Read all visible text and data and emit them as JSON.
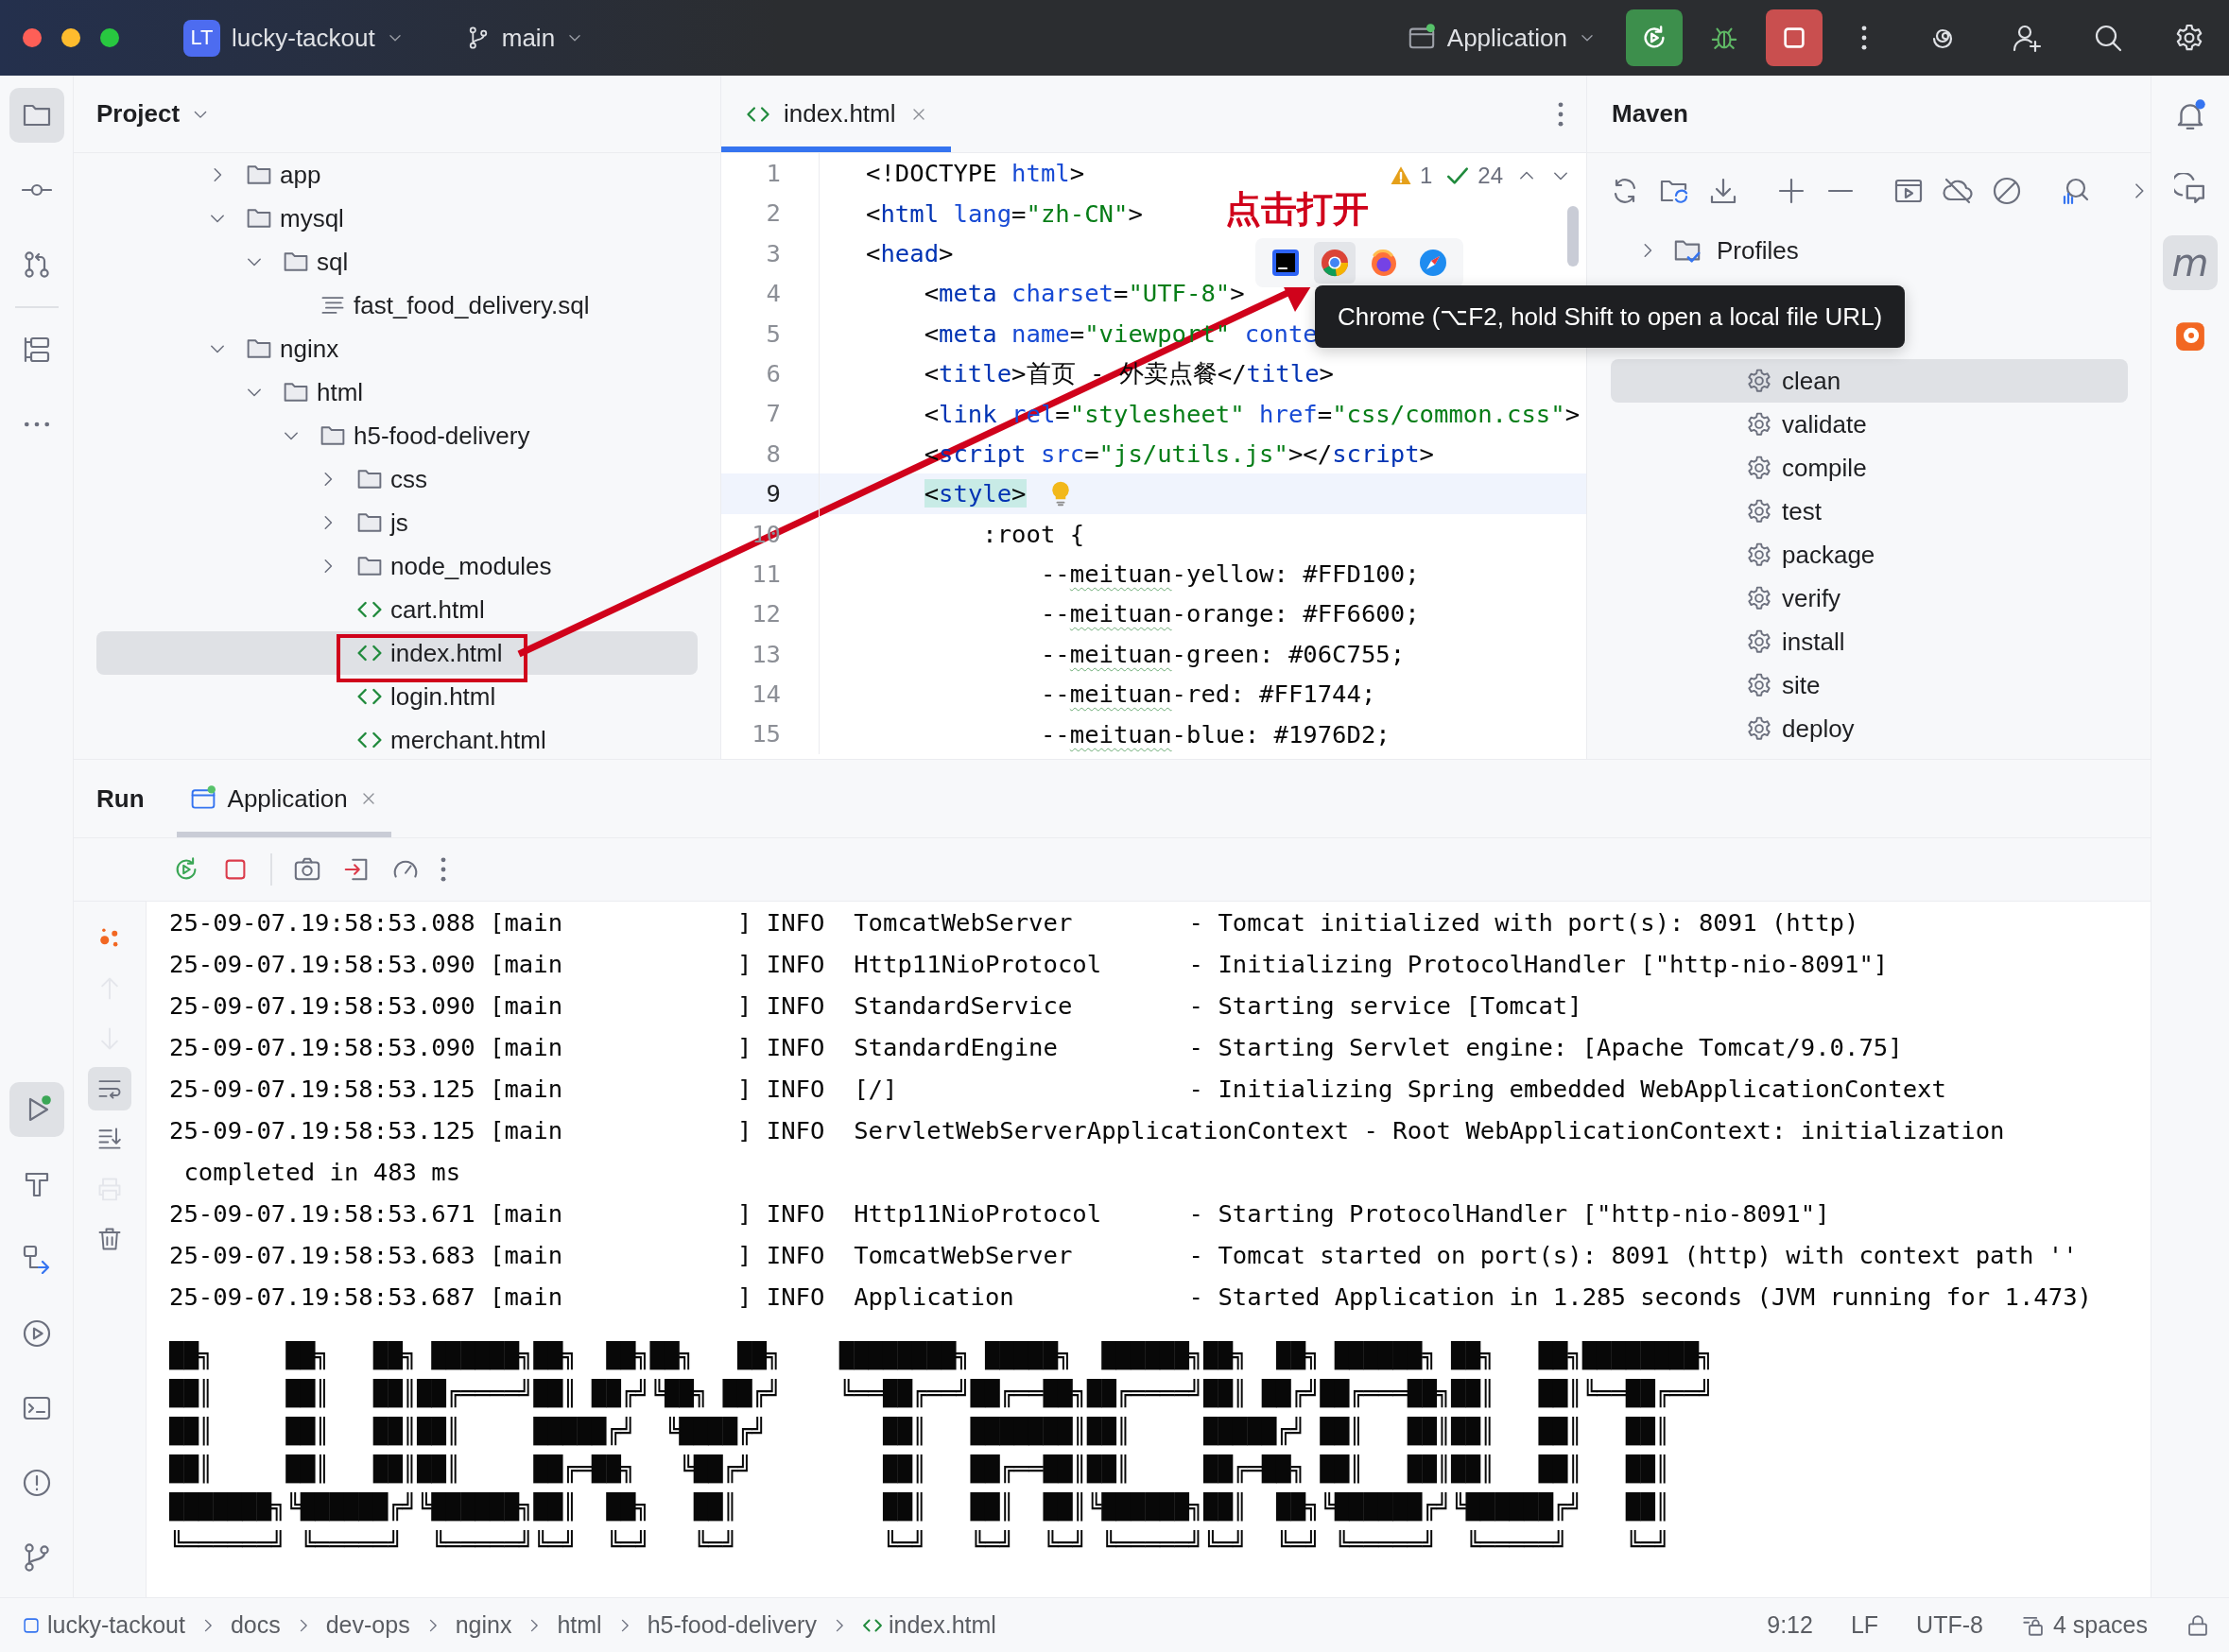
{
  "title_bar": {
    "project_badge": "LT",
    "project": "lucky-tackout",
    "branch": "main",
    "run_config": "Application"
  },
  "left_toolbar": {
    "top": [
      {
        "kind": "project",
        "selected": true
      },
      {
        "kind": "commit",
        "selected": false
      },
      {
        "kind": "pull-requests",
        "selected": false
      },
      {
        "kind": "structure",
        "selected": false
      },
      {
        "kind": "more",
        "selected": false
      }
    ],
    "bottom": [
      {
        "kind": "run",
        "selected": true
      },
      {
        "kind": "build",
        "selected": false
      },
      {
        "kind": "services",
        "selected": false
      },
      {
        "kind": "run-circle",
        "selected": false
      },
      {
        "kind": "terminal",
        "selected": false
      },
      {
        "kind": "problems",
        "selected": false
      },
      {
        "kind": "git",
        "selected": false
      }
    ]
  },
  "right_toolbar": [
    {
      "kind": "notifications",
      "selected": false
    },
    {
      "kind": "ai-chat",
      "selected": false
    },
    {
      "kind": "maven",
      "selected": true,
      "glyph": "m"
    },
    {
      "kind": "plugin",
      "selected": false
    }
  ],
  "project_panel": {
    "title": "Project",
    "tree": [
      {
        "name": "app",
        "kind": "folder",
        "expanded": false,
        "selected": false
      },
      {
        "name": "mysql",
        "kind": "folder",
        "expanded": true,
        "selected": false,
        "children": [
          {
            "name": "sql",
            "kind": "folder",
            "expanded": true,
            "selected": false,
            "children": [
              {
                "name": "fast_food_delivery.sql",
                "kind": "sql",
                "selected": false
              }
            ]
          }
        ]
      },
      {
        "name": "nginx",
        "kind": "folder",
        "expanded": true,
        "selected": false,
        "children": [
          {
            "name": "html",
            "kind": "folder",
            "expanded": true,
            "selected": false,
            "children": [
              {
                "name": "h5-food-delivery",
                "kind": "folder",
                "expanded": true,
                "selected": false,
                "children": [
                  {
                    "name": "css",
                    "kind": "folder",
                    "expanded": false,
                    "selected": false
                  },
                  {
                    "name": "js",
                    "kind": "folder",
                    "expanded": false,
                    "selected": false
                  },
                  {
                    "name": "node_modules",
                    "kind": "folder",
                    "expanded": false,
                    "selected": false
                  },
                  {
                    "name": "cart.html",
                    "kind": "html",
                    "selected": false
                  },
                  {
                    "name": "index.html",
                    "kind": "html",
                    "selected": true
                  },
                  {
                    "name": "login.html",
                    "kind": "html",
                    "selected": false
                  },
                  {
                    "name": "merchant.html",
                    "kind": "html",
                    "selected": false
                  }
                ]
              }
            ]
          }
        ]
      }
    ]
  },
  "editor": {
    "tab": {
      "label": "index.html",
      "selected": true
    },
    "inspections": {
      "warnings": "1",
      "passed": "24"
    },
    "lines": [
      {
        "number": "1",
        "current": false,
        "segments": [
          {
            "text": "<!DOCTYPE",
            "kind": "plain"
          },
          {
            "text": " html",
            "kind": "attr"
          },
          {
            "text": ">",
            "kind": "plain"
          }
        ]
      },
      {
        "number": "2",
        "current": false,
        "segments": [
          {
            "text": "<",
            "kind": "plain"
          },
          {
            "text": "html",
            "kind": "tag"
          },
          {
            "text": " lang",
            "kind": "attr"
          },
          {
            "text": "=",
            "kind": "plain"
          },
          {
            "text": "\"zh-CN\"",
            "kind": "str"
          },
          {
            "text": ">",
            "kind": "plain"
          }
        ]
      },
      {
        "number": "3",
        "current": false,
        "segments": [
          {
            "text": "<",
            "kind": "plain"
          },
          {
            "text": "head",
            "kind": "tag"
          },
          {
            "text": ">",
            "kind": "plain"
          }
        ]
      },
      {
        "number": "4",
        "current": false,
        "segments": [
          {
            "text": "    <",
            "kind": "plain"
          },
          {
            "text": "meta",
            "kind": "tag"
          },
          {
            "text": " charset",
            "kind": "attr"
          },
          {
            "text": "=",
            "kind": "plain"
          },
          {
            "text": "\"UTF-8\"",
            "kind": "str"
          },
          {
            "text": ">",
            "kind": "plain"
          }
        ]
      },
      {
        "number": "5",
        "current": false,
        "segments": [
          {
            "text": "    <",
            "kind": "plain"
          },
          {
            "text": "meta",
            "kind": "tag"
          },
          {
            "text": " name",
            "kind": "attr"
          },
          {
            "text": "=",
            "kind": "plain"
          },
          {
            "text": "\"viewport\"",
            "kind": "str"
          },
          {
            "text": " conte",
            "kind": "attr"
          }
        ]
      },
      {
        "number": "6",
        "current": false,
        "segments": [
          {
            "text": "    <",
            "kind": "plain"
          },
          {
            "text": "title",
            "kind": "tag"
          },
          {
            "text": ">首页 - 外卖点餐</",
            "kind": "plain"
          },
          {
            "text": "title",
            "kind": "tag"
          },
          {
            "text": ">",
            "kind": "plain"
          }
        ]
      },
      {
        "number": "7",
        "current": false,
        "segments": [
          {
            "text": "    <",
            "kind": "plain"
          },
          {
            "text": "link",
            "kind": "tag"
          },
          {
            "text": " rel",
            "kind": "attr"
          },
          {
            "text": "=",
            "kind": "plain"
          },
          {
            "text": "\"stylesheet\"",
            "kind": "str"
          },
          {
            "text": " href",
            "kind": "attr"
          },
          {
            "text": "=",
            "kind": "plain"
          },
          {
            "text": "\"css/common.css\"",
            "kind": "str"
          },
          {
            "text": ">",
            "kind": "plain"
          }
        ]
      },
      {
        "number": "8",
        "current": false,
        "segments": [
          {
            "text": "    <",
            "kind": "plain"
          },
          {
            "text": "script",
            "kind": "tag"
          },
          {
            "text": " src",
            "kind": "attr"
          },
          {
            "text": "=",
            "kind": "plain"
          },
          {
            "text": "\"js/utils.js\"",
            "kind": "str"
          },
          {
            "text": "></",
            "kind": "plain"
          },
          {
            "text": "script",
            "kind": "tag"
          },
          {
            "text": ">",
            "kind": "plain"
          }
        ]
      },
      {
        "number": "9",
        "current": true,
        "segments": [
          {
            "text": "    <",
            "kind": "match"
          },
          {
            "text": "style",
            "kind": "match-tag"
          },
          {
            "text": ">",
            "kind": "match"
          }
        ]
      },
      {
        "number": "10",
        "current": false,
        "segments": [
          {
            "text": "        :root {",
            "kind": "plain"
          }
        ]
      },
      {
        "number": "11",
        "current": false,
        "segments": [
          {
            "text": "            --",
            "kind": "plain"
          },
          {
            "text": "meituan",
            "kind": "typo"
          },
          {
            "text": "-yellow: #FFD100;",
            "kind": "plain"
          }
        ]
      },
      {
        "number": "12",
        "current": false,
        "segments": [
          {
            "text": "            --",
            "kind": "plain"
          },
          {
            "text": "meituan",
            "kind": "typo"
          },
          {
            "text": "-orange: #FF6600;",
            "kind": "plain"
          }
        ]
      },
      {
        "number": "13",
        "current": false,
        "segments": [
          {
            "text": "            --",
            "kind": "plain"
          },
          {
            "text": "meituan",
            "kind": "typo"
          },
          {
            "text": "-green: #06C755;",
            "kind": "plain"
          }
        ]
      },
      {
        "number": "14",
        "current": false,
        "segments": [
          {
            "text": "            --",
            "kind": "plain"
          },
          {
            "text": "meituan",
            "kind": "typo"
          },
          {
            "text": "-red: #FF1744;",
            "kind": "plain"
          }
        ]
      },
      {
        "number": "15",
        "current": false,
        "segments": [
          {
            "text": "            --",
            "kind": "plain"
          },
          {
            "text": "meituan",
            "kind": "typo"
          },
          {
            "text": "-blue: #1976D2;",
            "kind": "plain"
          }
        ]
      }
    ],
    "browser_popup": [
      {
        "kind": "intellij",
        "selected": false
      },
      {
        "kind": "chrome",
        "selected": true
      },
      {
        "kind": "firefox",
        "selected": false
      },
      {
        "kind": "safari",
        "selected": false
      }
    ],
    "tooltip": "Chrome (⌥F2, hold Shift to open a local file URL)"
  },
  "annotation": {
    "label": "点击打开"
  },
  "maven": {
    "title": "Maven",
    "profiles": {
      "name": "Profiles",
      "expanded": false
    },
    "lifecycle": [
      {
        "name": "clean",
        "selected": true
      },
      {
        "name": "validate",
        "selected": false
      },
      {
        "name": "compile",
        "selected": false
      },
      {
        "name": "test",
        "selected": false
      },
      {
        "name": "package",
        "selected": false
      },
      {
        "name": "verify",
        "selected": false
      },
      {
        "name": "install",
        "selected": false
      },
      {
        "name": "site",
        "selected": false
      },
      {
        "name": "deploy",
        "selected": false
      }
    ]
  },
  "run": {
    "title": "Run",
    "tab": {
      "label": "Application",
      "selected": true
    },
    "gutter": [
      {
        "kind": "spring",
        "selected": false,
        "disabled": false
      },
      {
        "kind": "up",
        "selected": false,
        "disabled": true
      },
      {
        "kind": "down",
        "selected": false,
        "disabled": true
      },
      {
        "kind": "wrap",
        "selected": true,
        "disabled": false
      },
      {
        "kind": "scroll-end",
        "selected": false,
        "disabled": false
      },
      {
        "kind": "print",
        "selected": false,
        "disabled": true
      },
      {
        "kind": "trash",
        "selected": false,
        "disabled": false
      }
    ],
    "console": [
      "25-09-07.19:58:53.088 [main            ] INFO  TomcatWebServer        - Tomcat initialized with port(s): 8091 (http)",
      "25-09-07.19:58:53.090 [main            ] INFO  Http11NioProtocol      - Initializing ProtocolHandler [\"http-nio-8091\"]",
      "25-09-07.19:58:53.090 [main            ] INFO  StandardService        - Starting service [Tomcat]",
      "25-09-07.19:58:53.090 [main            ] INFO  StandardEngine         - Starting Servlet engine: [Apache Tomcat/9.0.75]",
      "25-09-07.19:58:53.125 [main            ] INFO  [/]                    - Initializing Spring embedded WebApplicationContext",
      "25-09-07.19:58:53.125 [main            ] INFO  ServletWebServerApplicationContext - Root WebApplicationContext: initialization",
      " completed in 483 ms",
      "25-09-07.19:58:53.671 [main            ] INFO  Http11NioProtocol      - Starting ProtocolHandler [\"http-nio-8091\"]",
      "25-09-07.19:58:53.683 [main            ] INFO  TomcatWebServer        - Tomcat started on port(s): 8091 (http) with context path ''",
      "25-09-07.19:58:53.687 [main            ] INFO  Application            - Started Application in 1.285 seconds (JVM running for 1.473)"
    ],
    "banner": [
      "██╗     ██╗   ██╗ ██████╗██╗  ██╗██╗   ██╗    ████████╗ █████╗  ██████╗██╗  ██╗ ██████╗ ██╗   ██╗████████╗",
      "██║     ██║   ██║██╔════╝██║ ██╔╝╚██╗ ██╔╝    ╚══██╔══╝██╔══██╗██╔════╝██║ ██╔╝██╔═══██╗██║   ██║╚══██╔══╝",
      "██║     ██║   ██║██║     █████╔╝  ╚████╔╝        ██║   ███████║██║     █████╔╝ ██║   ██║██║   ██║   ██║",
      "██║     ██║   ██║██║     ██╔═██╗   ╚██╔╝         ██║   ██╔══██║██║     ██╔═██╗ ██║   ██║██║   ██║   ██║",
      "███████╗╚██████╔╝╚██████╗██║  ██╗   ██║          ██║   ██║  ██║╚██████╗██║  ██╗╚██████╔╝╚██████╔╝   ██║",
      "╚══════╝ ╚═════╝  ╚═════╝╚═╝  ╚═╝   ╚═╝          ╚═╝   ╚═╝  ╚═╝ ╚═════╝╚═╝  ╚═╝ ╚═════╝  ╚═════╝    ╚═╝"
    ]
  },
  "status_bar": {
    "breadcrumbs": [
      {
        "label": "lucky-tackout",
        "kind": "module"
      },
      {
        "label": "docs",
        "kind": "folder"
      },
      {
        "label": "dev-ops",
        "kind": "folder"
      },
      {
        "label": "nginx",
        "kind": "folder"
      },
      {
        "label": "html",
        "kind": "folder"
      },
      {
        "label": "h5-food-delivery",
        "kind": "folder"
      },
      {
        "label": "index.html",
        "kind": "html"
      }
    ],
    "position": "9:12",
    "line_separator": "LF",
    "encoding": "UTF-8",
    "indent": "4 spaces"
  }
}
